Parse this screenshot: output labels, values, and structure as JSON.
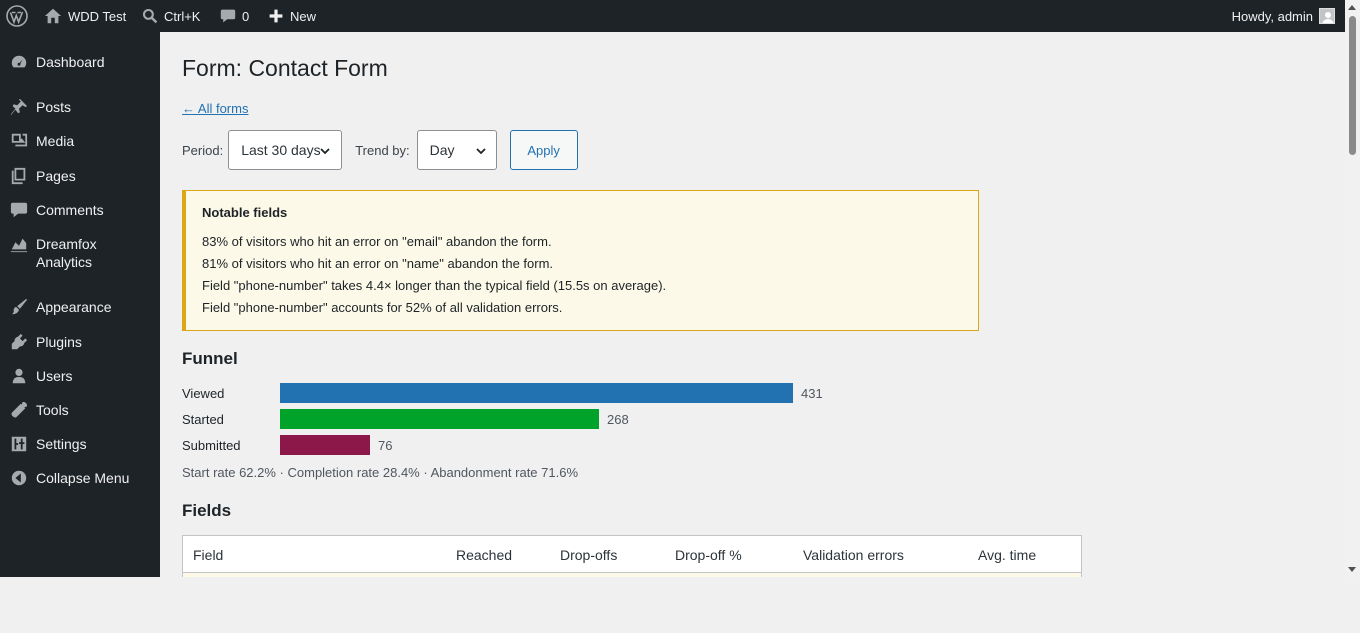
{
  "adminbar": {
    "site_name": "WDD Test",
    "search_shortcut": "Ctrl+K",
    "comments_count": "0",
    "new_label": "New",
    "howdy": "Howdy, admin"
  },
  "sidebar": {
    "items": [
      {
        "label": "Dashboard",
        "icon": "dashboard-icon"
      },
      {
        "label": "Posts",
        "icon": "pushpin-icon"
      },
      {
        "label": "Media",
        "icon": "media-icon"
      },
      {
        "label": "Pages",
        "icon": "pages-icon"
      },
      {
        "label": "Comments",
        "icon": "comment-icon"
      },
      {
        "label": "Dreamfox Analytics",
        "icon": "chart-icon"
      },
      {
        "label": "Appearance",
        "icon": "brush-icon"
      },
      {
        "label": "Plugins",
        "icon": "plug-icon"
      },
      {
        "label": "Users",
        "icon": "user-icon"
      },
      {
        "label": "Tools",
        "icon": "wrench-icon"
      },
      {
        "label": "Settings",
        "icon": "sliders-icon"
      },
      {
        "label": "Collapse Menu",
        "icon": "collapse-icon"
      }
    ]
  },
  "page": {
    "title": "Form: Contact Form",
    "back_link": "← All forms"
  },
  "filters": {
    "period_label": "Period:",
    "period_value": "Last 30 days",
    "trend_label": "Trend by:",
    "trend_value": "Day",
    "apply_label": "Apply"
  },
  "notice": {
    "title": "Notable fields",
    "lines": [
      "83% of visitors who hit an error on \"email\" abandon the form.",
      "81% of visitors who hit an error on \"name\" abandon the form.",
      "Field \"phone-number\" takes 4.4× longer than the typical field (15.5s on average).",
      "Field \"phone-number\" accounts for 52% of all validation errors."
    ]
  },
  "funnel": {
    "title": "Funnel",
    "rows": [
      {
        "label": "Viewed",
        "count": 431,
        "color": "#2271b1"
      },
      {
        "label": "Started",
        "count": 268,
        "color": "#00a32a"
      },
      {
        "label": "Submitted",
        "count": 76,
        "color": "#8c1749"
      }
    ],
    "rates": "Start rate 62.2% · Completion rate 28.4% · Abandonment rate 71.6%"
  },
  "fields": {
    "title": "Fields",
    "columns": [
      "Field",
      "Reached",
      "Drop-offs",
      "Drop-off %",
      "Validation errors",
      "Avg. time"
    ]
  },
  "colors": {
    "adminbar_bg": "#1d2327",
    "accent": "#2271b1",
    "notice_border": "#dba617",
    "notice_bg": "#fcf9e8"
  }
}
